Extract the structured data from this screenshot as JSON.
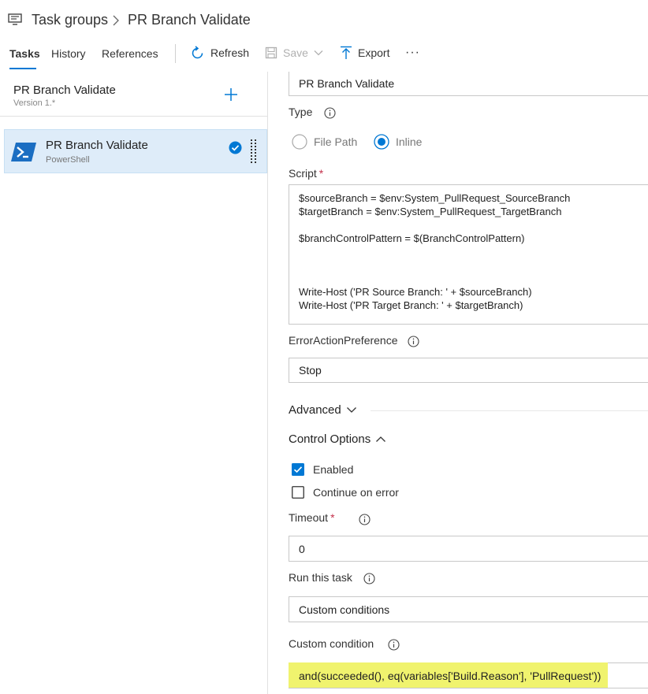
{
  "breadcrumb": {
    "parent": "Task groups",
    "current": "PR Branch Validate"
  },
  "tabs": [
    {
      "label": "Tasks",
      "active": true
    },
    {
      "label": "History",
      "active": false
    },
    {
      "label": "References",
      "active": false
    }
  ],
  "toolbar": {
    "refresh_label": "Refresh",
    "save_label": "Save",
    "export_label": "Export",
    "more_label": "···"
  },
  "left_pane": {
    "group_name": "PR Branch Validate",
    "version": "Version 1.*",
    "task": {
      "name": "PR Branch Validate",
      "type": "PowerShell",
      "enabled": true
    }
  },
  "form": {
    "display_name_value": "PR Branch Validate",
    "type_label": "Type",
    "type_options": [
      {
        "label": "File Path",
        "selected": false
      },
      {
        "label": "Inline",
        "selected": true
      }
    ],
    "script_label": "Script",
    "required_mark": "*",
    "script_lines": [
      "$sourceBranch = $env:System_PullRequest_SourceBranch",
      "$targetBranch = $env:System_PullRequest_TargetBranch",
      "",
      "$branchControlPattern = $(BranchControlPattern)",
      "",
      "",
      "",
      "Write-Host ('PR Source Branch: ' + $sourceBranch)",
      "Write-Host ('PR Target Branch: ' + $targetBranch)"
    ],
    "error_action_label": "ErrorActionPreference",
    "error_action_value": "Stop",
    "advanced_label": "Advanced",
    "control_options_label": "Control Options",
    "enabled_label": "Enabled",
    "enabled_checked": true,
    "continue_on_error_label": "Continue on error",
    "continue_on_error_checked": false,
    "timeout_label": "Timeout",
    "timeout_value": "0",
    "run_task_label": "Run this task",
    "run_task_value": "Custom conditions",
    "custom_condition_label": "Custom condition",
    "custom_condition_value": "and(succeeded(), eq(variables['Build.Reason'], 'PullRequest'))"
  },
  "colors": {
    "accent": "#0078d4",
    "selection_bg": "#deecf9",
    "highlight": "#f4f77e",
    "required": "#c4314b"
  }
}
